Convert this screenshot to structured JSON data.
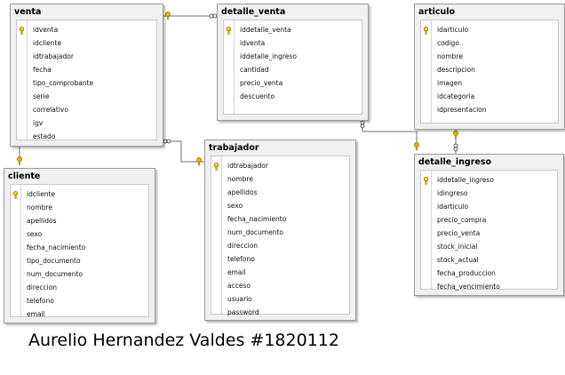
{
  "tables": {
    "venta": {
      "title": "venta",
      "columns": [
        {
          "name": "idventa",
          "pk": true
        },
        {
          "name": "idcliente",
          "pk": false
        },
        {
          "name": "idtrabajador",
          "pk": false
        },
        {
          "name": "fecha",
          "pk": false
        },
        {
          "name": "tipo_comprobante",
          "pk": false
        },
        {
          "name": "serie",
          "pk": false
        },
        {
          "name": "correlativo",
          "pk": false
        },
        {
          "name": "igv",
          "pk": false
        },
        {
          "name": "estado",
          "pk": false
        }
      ]
    },
    "detalle_venta": {
      "title": "detalle_venta",
      "columns": [
        {
          "name": "iddetalle_venta",
          "pk": true
        },
        {
          "name": "idventa",
          "pk": false
        },
        {
          "name": "iddetalle_ingreso",
          "pk": false
        },
        {
          "name": "cantidad",
          "pk": false
        },
        {
          "name": "precio_venta",
          "pk": false
        },
        {
          "name": "descuento",
          "pk": false
        }
      ]
    },
    "articulo": {
      "title": "articulo",
      "columns": [
        {
          "name": "idarticulo",
          "pk": true
        },
        {
          "name": "codigo",
          "pk": false
        },
        {
          "name": "nombre",
          "pk": false
        },
        {
          "name": "descripcion",
          "pk": false
        },
        {
          "name": "imagen",
          "pk": false
        },
        {
          "name": "idcategoria",
          "pk": false
        },
        {
          "name": "idpresentacion",
          "pk": false
        }
      ]
    },
    "cliente": {
      "title": "cliente",
      "columns": [
        {
          "name": "idcliente",
          "pk": true
        },
        {
          "name": "nombre",
          "pk": false
        },
        {
          "name": "apellidos",
          "pk": false
        },
        {
          "name": "sexo",
          "pk": false
        },
        {
          "name": "fecha_nacimiento",
          "pk": false
        },
        {
          "name": "tipo_documento",
          "pk": false
        },
        {
          "name": "num_documento",
          "pk": false
        },
        {
          "name": "direccion",
          "pk": false
        },
        {
          "name": "telefono",
          "pk": false
        },
        {
          "name": "email",
          "pk": false
        }
      ]
    },
    "trabajador": {
      "title": "trabajador",
      "columns": [
        {
          "name": "idtrabajador",
          "pk": true
        },
        {
          "name": "nombre",
          "pk": false
        },
        {
          "name": "apellidos",
          "pk": false
        },
        {
          "name": "sexo",
          "pk": false
        },
        {
          "name": "fecha_nacimiento",
          "pk": false
        },
        {
          "name": "num_documento",
          "pk": false
        },
        {
          "name": "direccion",
          "pk": false
        },
        {
          "name": "telefono",
          "pk": false
        },
        {
          "name": "email",
          "pk": false
        },
        {
          "name": "acceso",
          "pk": false
        },
        {
          "name": "usuario",
          "pk": false
        },
        {
          "name": "password",
          "pk": false
        }
      ]
    },
    "detalle_ingreso": {
      "title": "detalle_ingreso",
      "columns": [
        {
          "name": "iddetalle_ingreso",
          "pk": true
        },
        {
          "name": "idingreso",
          "pk": false
        },
        {
          "name": "idarticulo",
          "pk": false
        },
        {
          "name": "precio_compra",
          "pk": false
        },
        {
          "name": "precio_venta",
          "pk": false
        },
        {
          "name": "stock_inicial",
          "pk": false
        },
        {
          "name": "stock_actual",
          "pk": false
        },
        {
          "name": "fecha_produccion",
          "pk": false
        },
        {
          "name": "fecha_vencimiento",
          "pk": false
        }
      ]
    }
  },
  "relationships": [
    {
      "from": "detalle_venta",
      "to": "venta"
    },
    {
      "from": "venta",
      "to": "cliente"
    },
    {
      "from": "venta",
      "to": "trabajador"
    },
    {
      "from": "detalle_venta",
      "to": "detalle_ingreso"
    },
    {
      "from": "detalle_ingreso",
      "to": "articulo"
    }
  ],
  "icons": {
    "primary_key": "key-icon",
    "relationship_many_end": "infinity-icon",
    "relationship_one_end": "key-icon"
  },
  "colors": {
    "key_gold": "#e5b800",
    "relationship_line": "#707070",
    "canvas": "#ffffff"
  },
  "caption": "Aurelio Hernandez Valdes #1820112"
}
